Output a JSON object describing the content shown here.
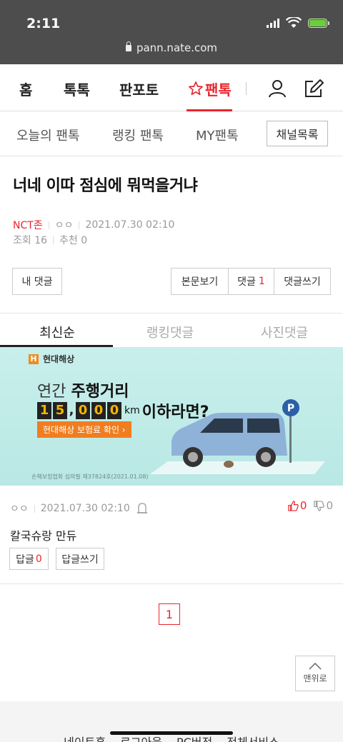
{
  "status_bar": {
    "time": "2:11",
    "url": "pann.nate.com"
  },
  "top_nav": {
    "items": [
      "홈",
      "톡톡",
      "판포토"
    ],
    "active": "팬톡"
  },
  "sub_nav": {
    "items": [
      "오늘의 팬톡",
      "랭킹 팬톡",
      "MY팬톡"
    ],
    "channel_button": "채널목록"
  },
  "post": {
    "title": "너네 이따 점심에 뭐먹을거냐",
    "category": "NCT존",
    "author": "ㅇㅇ",
    "date": "2021.07.30 02:10",
    "views": "조회 16",
    "recommend": "추천 0"
  },
  "actions": {
    "my_comments": "내 댓글",
    "view_body": "본문보기",
    "comments_label": "댓글",
    "comments_count": "1",
    "write_comment": "댓글쓰기"
  },
  "comment_tabs": [
    "최신순",
    "랭킹댓글",
    "사진댓글"
  ],
  "ad": {
    "brand": "현대해상",
    "line1_a": "연간",
    "line1_b": "주행거리",
    "digits": [
      "1",
      "5",
      ",",
      "0",
      "0",
      "0"
    ],
    "unit": "km",
    "line2_tail": "이하라면?",
    "cta": "현대해상 보험료 확인 ›",
    "fine_print": "손해보험협회 심의필 제37824호(2021.01.08)"
  },
  "comment": {
    "author": "ㅇㅇ",
    "date": "2021.07.30 02:10",
    "text": "칼국슈랑 만듀",
    "up_votes": "0",
    "down_votes": "0",
    "reply_label": "답글",
    "reply_count": "0",
    "write_reply": "답글쓰기"
  },
  "pagination": {
    "current": "1"
  },
  "to_top": "맨위로",
  "footer": {
    "links": [
      "네이트홈",
      "로그아웃",
      "PC버전",
      "전체서비스"
    ]
  },
  "colors": {
    "accent": "#e8262d",
    "status_bg": "#4d4d4d",
    "ad_bg": "#c8efec"
  }
}
